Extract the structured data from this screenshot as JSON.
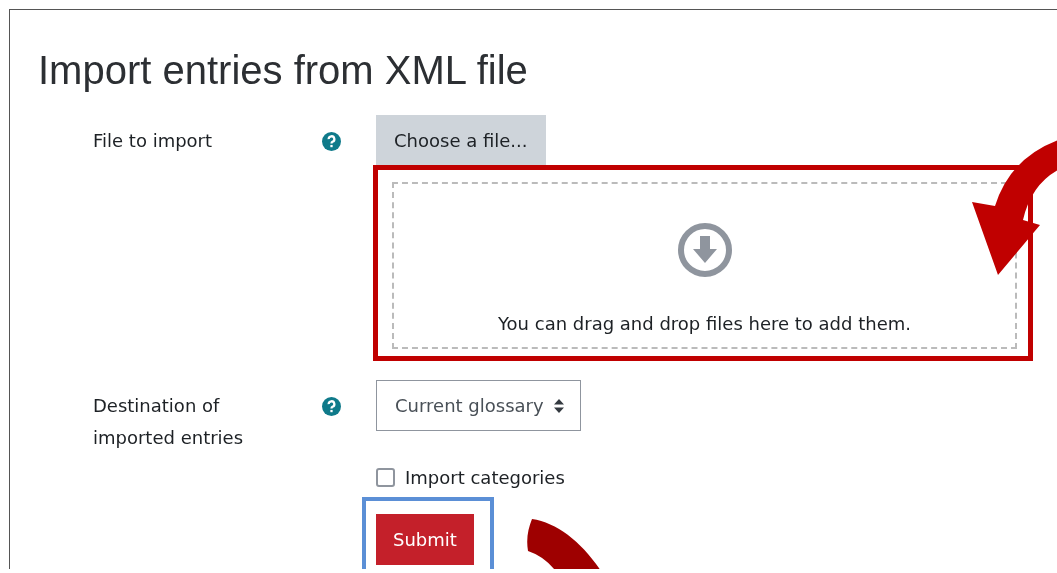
{
  "title": "Import entries from XML file",
  "fields": [
    {
      "kind": "file",
      "label": "File to import",
      "button": "Choose a file...",
      "dropzone_text": "You can drag and drop files here to add them."
    },
    {
      "kind": "select",
      "label": "Destination of imported entries",
      "value": "Current glossary"
    }
  ],
  "checkbox": {
    "label": "Import categories",
    "checked": false
  },
  "submit": {
    "label": "Submit"
  }
}
